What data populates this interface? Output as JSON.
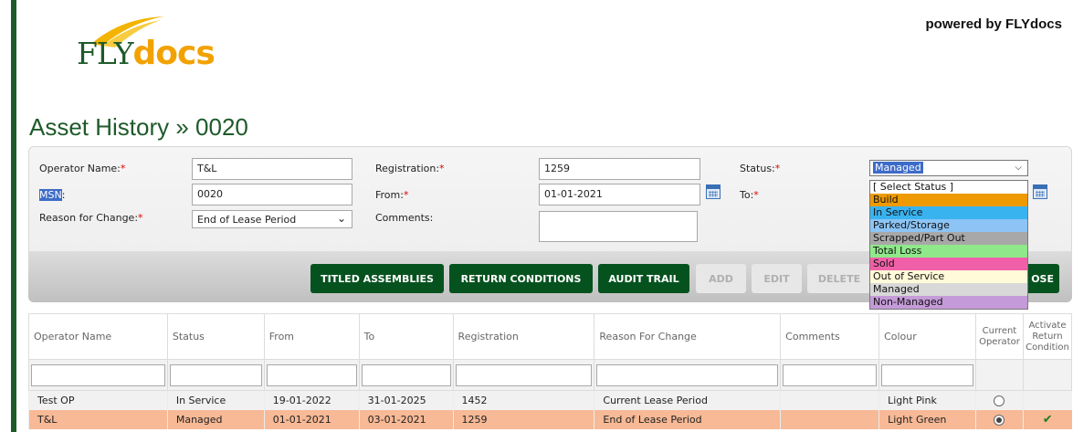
{
  "brand": {
    "fly": "FLY",
    "docs": "docs",
    "powered": "powered by FLYdocs"
  },
  "page": {
    "title": "Asset History » 0020"
  },
  "form": {
    "operator_name": {
      "label": "Operator Name:",
      "value": "T&L"
    },
    "registration": {
      "label": "Registration:",
      "value": "1259"
    },
    "status": {
      "label": "Status:",
      "value": "Managed"
    },
    "msn": {
      "label": "MSN",
      "colon": ":",
      "value": "0020"
    },
    "from": {
      "label": "From:",
      "value": "01-01-2021"
    },
    "to": {
      "label": "To:"
    },
    "reason": {
      "label": "Reason for Change:",
      "value": "End of Lease Period"
    },
    "comments": {
      "label": "Comments:"
    },
    "required_mark": "*"
  },
  "status_options": [
    {
      "label": "[ Select Status ]",
      "color": "#ffffff"
    },
    {
      "label": "Build",
      "color": "#ef9a00"
    },
    {
      "label": "In Service",
      "color": "#39b3f0"
    },
    {
      "label": "Parked/Storage",
      "color": "#8cc4f5"
    },
    {
      "label": "Scrapped/Part Out",
      "color": "#a8a8a8"
    },
    {
      "label": "Total Loss",
      "color": "#8fe88a"
    },
    {
      "label": "Sold",
      "color": "#f060a8"
    },
    {
      "label": "Out of Service",
      "color": "#fffad8"
    },
    {
      "label": "Managed",
      "color": "#d8d8d8"
    },
    {
      "label": "Non-Managed",
      "color": "#c59ad8"
    }
  ],
  "buttons": {
    "titled_assemblies": "TITLED ASSEMBLIES",
    "return_conditions": "RETURN CONDITIONS",
    "audit_trail": "AUDIT TRAIL",
    "add": "ADD",
    "edit": "EDIT",
    "delete": "DELETE",
    "close": "OSE"
  },
  "table": {
    "headers": {
      "operator_name": "Operator Name",
      "status": "Status",
      "from": "From",
      "to": "To",
      "registration": "Registration",
      "reason": "Reason For Change",
      "comments": "Comments",
      "colour": "Colour",
      "current_operator_1": "Current",
      "current_operator_2": "Operator",
      "activate_1": "Activate",
      "activate_2": "Return",
      "activate_3": "Condition"
    },
    "rows": [
      {
        "operator": "Test OP",
        "status": "In Service",
        "from": "19-01-2022",
        "to": "31-01-2025",
        "registration": "1452",
        "reason": "Current Lease Period",
        "comments": "",
        "colour": "Light Pink",
        "current": false
      },
      {
        "operator": "T&L",
        "status": "Managed",
        "from": "01-01-2021",
        "to": "03-01-2021",
        "registration": "1259",
        "reason": "End of Lease Period",
        "comments": "",
        "colour": "Light Green",
        "current": true
      }
    ]
  },
  "colors": {
    "brand_green": "#06521f",
    "brand_orange": "#f2a200",
    "row_highlight": "#f7b996"
  }
}
